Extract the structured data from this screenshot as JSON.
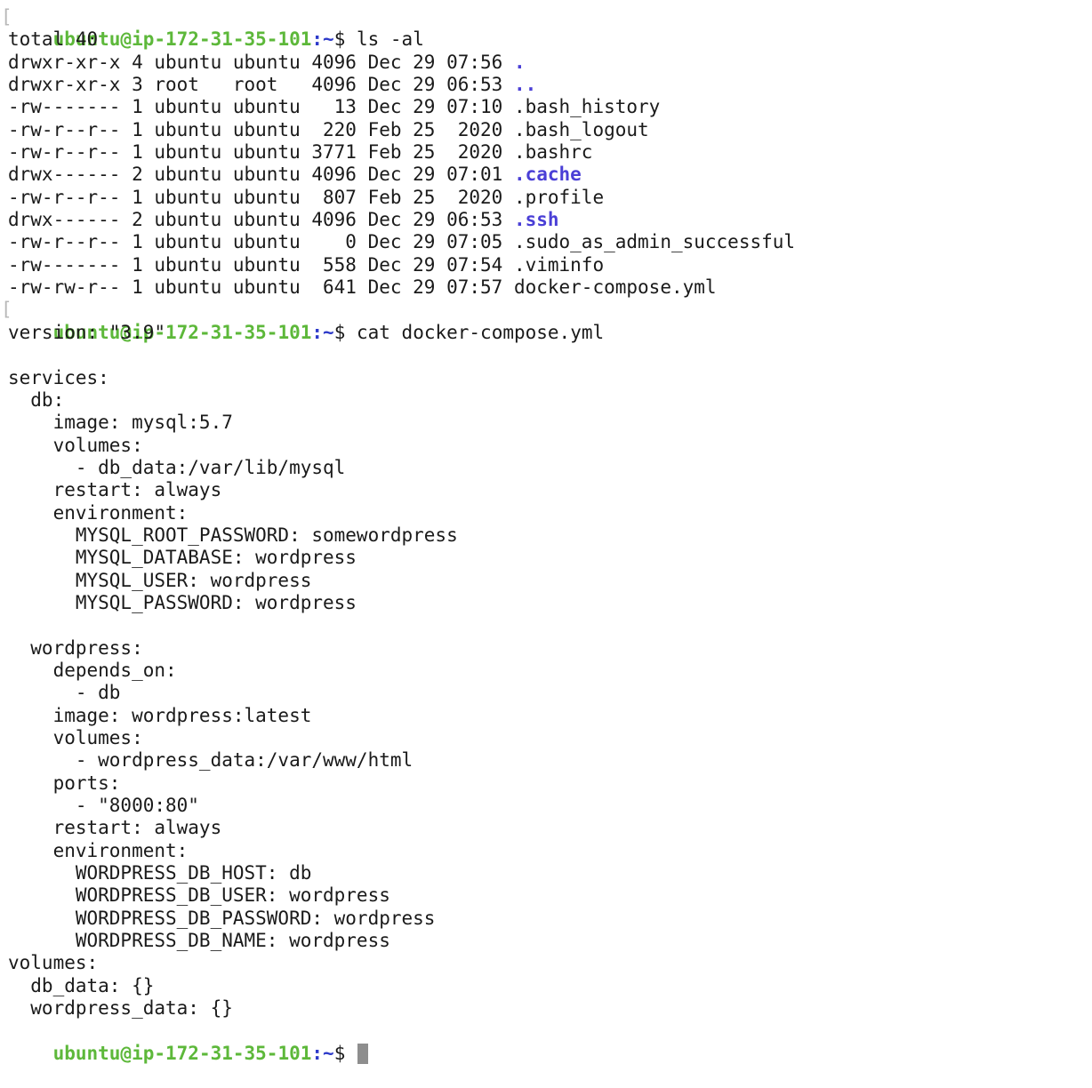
{
  "prompt": {
    "userhost": "ubuntu@ip-172-31-35-101",
    "colon": ":",
    "path": "~",
    "dollar": "$ ",
    "bracket": "["
  },
  "commands": [
    "ls -al",
    "cat docker-compose.yml"
  ],
  "ls_output": {
    "total": "total 40",
    "entries": [
      {
        "meta": "drwxr-xr-x 4 ubuntu ubuntu 4096 Dec 29 07:56 ",
        "name": ".",
        "is_dir": true
      },
      {
        "meta": "drwxr-xr-x 3 root   root   4096 Dec 29 06:53 ",
        "name": "..",
        "is_dir": true
      },
      {
        "meta": "-rw------- 1 ubuntu ubuntu   13 Dec 29 07:10 ",
        "name": ".bash_history",
        "is_dir": false
      },
      {
        "meta": "-rw-r--r-- 1 ubuntu ubuntu  220 Feb 25  2020 ",
        "name": ".bash_logout",
        "is_dir": false
      },
      {
        "meta": "-rw-r--r-- 1 ubuntu ubuntu 3771 Feb 25  2020 ",
        "name": ".bashrc",
        "is_dir": false
      },
      {
        "meta": "drwx------ 2 ubuntu ubuntu 4096 Dec 29 07:01 ",
        "name": ".cache",
        "is_dir": true
      },
      {
        "meta": "-rw-r--r-- 1 ubuntu ubuntu  807 Feb 25  2020 ",
        "name": ".profile",
        "is_dir": false
      },
      {
        "meta": "drwx------ 2 ubuntu ubuntu 4096 Dec 29 06:53 ",
        "name": ".ssh",
        "is_dir": true
      },
      {
        "meta": "-rw-r--r-- 1 ubuntu ubuntu    0 Dec 29 07:05 ",
        "name": ".sudo_as_admin_successful",
        "is_dir": false
      },
      {
        "meta": "-rw------- 1 ubuntu ubuntu  558 Dec 29 07:54 ",
        "name": ".viminfo",
        "is_dir": false
      },
      {
        "meta": "-rw-rw-r-- 1 ubuntu ubuntu  641 Dec 29 07:57 ",
        "name": "docker-compose.yml",
        "is_dir": false
      }
    ]
  },
  "cat_output": [
    "version: \"3.9\"",
    "",
    "services:",
    "  db:",
    "    image: mysql:5.7",
    "    volumes:",
    "      - db_data:/var/lib/mysql",
    "    restart: always",
    "    environment:",
    "      MYSQL_ROOT_PASSWORD: somewordpress",
    "      MYSQL_DATABASE: wordpress",
    "      MYSQL_USER: wordpress",
    "      MYSQL_PASSWORD: wordpress",
    "",
    "  wordpress:",
    "    depends_on:",
    "      - db",
    "    image: wordpress:latest",
    "    volumes:",
    "      - wordpress_data:/var/www/html",
    "    ports:",
    "      - \"8000:80\"",
    "    restart: always",
    "    environment:",
    "      WORDPRESS_DB_HOST: db",
    "      WORDPRESS_DB_USER: wordpress",
    "      WORDPRESS_DB_PASSWORD: wordpress",
    "      WORDPRESS_DB_NAME: wordpress",
    "volumes:",
    "  db_data: {}",
    "  wordpress_data: {}"
  ],
  "colors": {
    "prompt": "#5db83a",
    "path": "#2d3ac9",
    "directory": "#4a3fd6",
    "text": "#1a1a1a",
    "cursor": "#8e8e8e"
  }
}
